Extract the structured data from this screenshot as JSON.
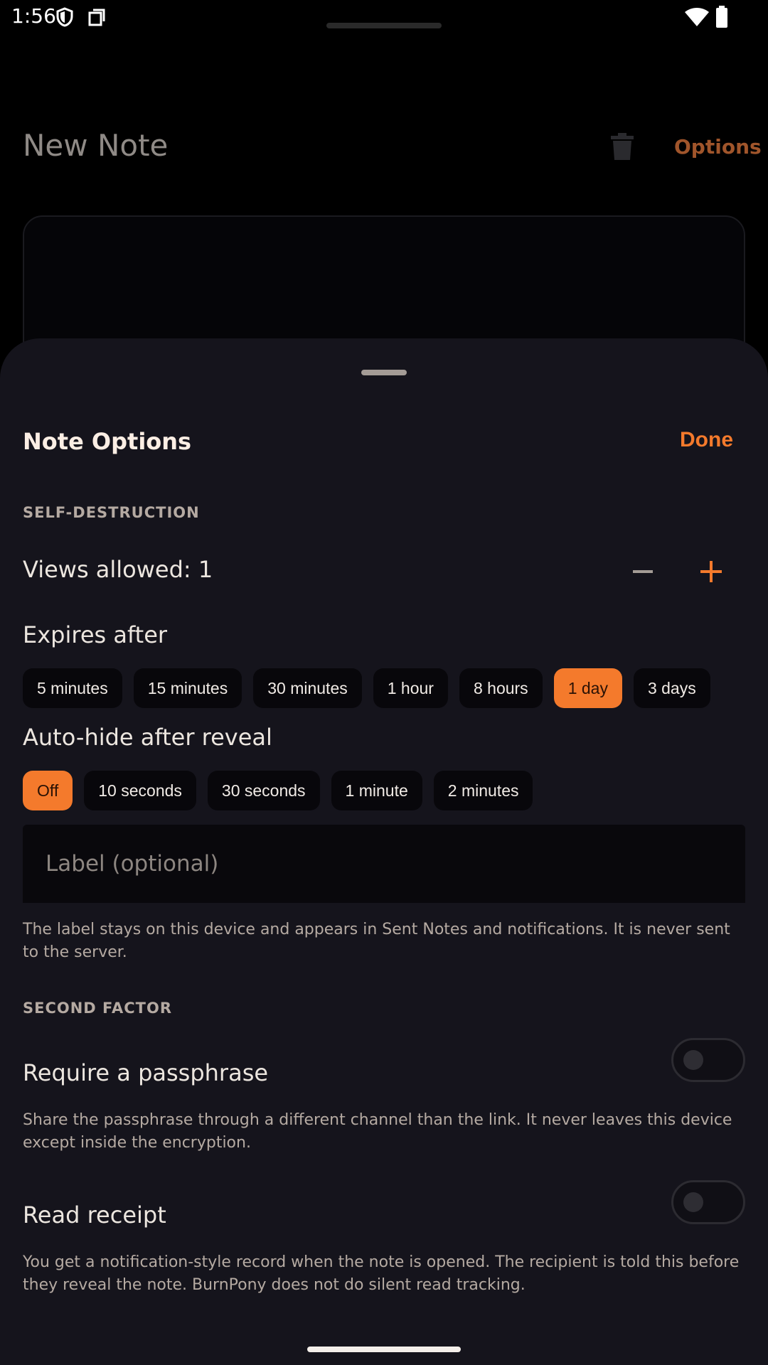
{
  "status_bar": {
    "time": "1:56",
    "icons": [
      "shield-icon",
      "sim-icon",
      "wifi-icon",
      "battery-icon"
    ]
  },
  "app": {
    "title": "New Note",
    "options_label": "Options",
    "trash_icon": "trash-icon"
  },
  "sheet": {
    "title": "Note Options",
    "done_label": "Done",
    "self_destruction": {
      "header": "SELF-DESTRUCTION",
      "views_label": "Views allowed: 1",
      "views_value": 1,
      "expires_label": "Expires after",
      "expires_options": [
        "5 minutes",
        "15 minutes",
        "30 minutes",
        "1 hour",
        "8 hours",
        "1 day",
        "3 days"
      ],
      "expires_selected": "1 day",
      "autohide_label": "Auto-hide after reveal",
      "autohide_options": [
        "Off",
        "10 seconds",
        "30 seconds",
        "1 minute",
        "2 minutes"
      ],
      "autohide_selected": "Off",
      "label_placeholder": "Label (optional)",
      "label_value": "",
      "label_help": "The label stays on this device and appears in Sent Notes and notifications. It is never sent to the server."
    },
    "second_factor": {
      "header": "SECOND FACTOR",
      "passphrase_label": "Require a passphrase",
      "passphrase_on": false,
      "passphrase_help": "Share the passphrase through a different channel than the link. It never leaves this device except inside the encryption.",
      "receipt_label": "Read receipt",
      "receipt_on": false,
      "receipt_help": "You get a notification-style record when the note is opened. The recipient is told this before they reveal the note. BurnPony does not do silent read tracking."
    }
  },
  "colors": {
    "accent": "#f47a2c",
    "sheet_bg": "#15141c",
    "chip_bg": "#08070b"
  }
}
